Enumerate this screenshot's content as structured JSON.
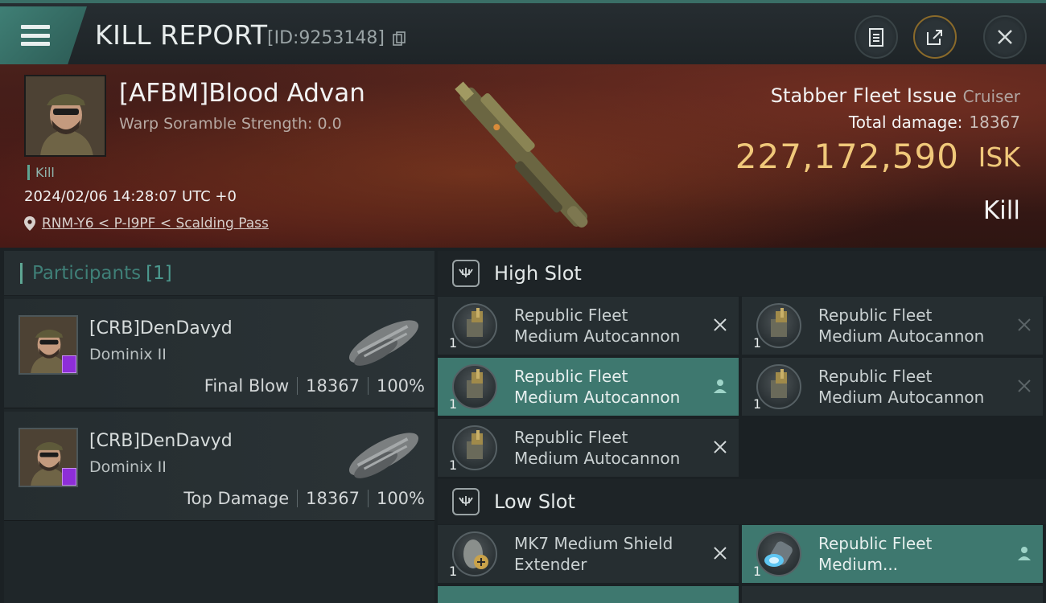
{
  "header": {
    "title": "KILL REPORT",
    "report_id": "[ID:9253148]"
  },
  "victim": {
    "name": "[AFBM]Blood Advan",
    "scramble": "Warp Soramble Strength: 0.0",
    "tag": "Kill",
    "datetime": "2024/02/06 14:28:07 UTC +0",
    "location": "RNM-Y6 < P-I9PF < Scalding Pass",
    "ship_name": "Stabber Fleet Issue",
    "ship_class": "Cruiser",
    "total_damage_label": "Total damage:",
    "total_damage": "18367",
    "isk_value": "227,172,590",
    "isk_unit": "ISK",
    "result": "Kill"
  },
  "participants": {
    "title": "Participants",
    "count": "[1]",
    "items": [
      {
        "name": "[CRB]DenDavyd",
        "ship": "Dominix II",
        "role": "Final Blow",
        "damage": "18367",
        "percent": "100%"
      },
      {
        "name": "[CRB]DenDavyd",
        "ship": "Dominix II",
        "role": "Top Damage",
        "damage": "18367",
        "percent": "100%"
      }
    ]
  },
  "fitting": {
    "high_slot": {
      "title": "High Slot",
      "modules": [
        {
          "line1": "Republic Fleet",
          "line2": "Medium Autocannon",
          "qty": "1",
          "status": "destroyed"
        },
        {
          "line1": "Republic Fleet",
          "line2": "Medium Autocannon",
          "qty": "1",
          "status": "destroyed"
        },
        {
          "line1": "Republic Fleet",
          "line2": "Medium Autocannon",
          "qty": "1",
          "status": "dropped"
        },
        {
          "line1": "Republic Fleet",
          "line2": "Medium Autocannon",
          "qty": "1",
          "status": "destroyed"
        },
        {
          "line1": "Republic Fleet",
          "line2": "Medium Autocannon",
          "qty": "1",
          "status": "destroyed"
        }
      ]
    },
    "low_slot": {
      "title": "Low Slot",
      "modules": [
        {
          "line1": "MK7 Medium Shield",
          "line2": "Extender",
          "qty": "1",
          "status": "destroyed"
        },
        {
          "line1": "Republic Fleet",
          "line2": "Medium...",
          "qty": "1",
          "status": "dropped"
        }
      ]
    }
  },
  "colors": {
    "accent_teal": "#3e786f",
    "isk_gold": "#f0c87a",
    "corp_badge": "#8e2ed8"
  },
  "icons": {
    "menu": "hamburger-icon",
    "copy": "copy-icon",
    "clipboard": "clipboard-icon",
    "share": "share-icon",
    "close": "close-icon",
    "location": "map-pin-icon",
    "destroyed": "x-icon",
    "dropped": "person-icon"
  }
}
